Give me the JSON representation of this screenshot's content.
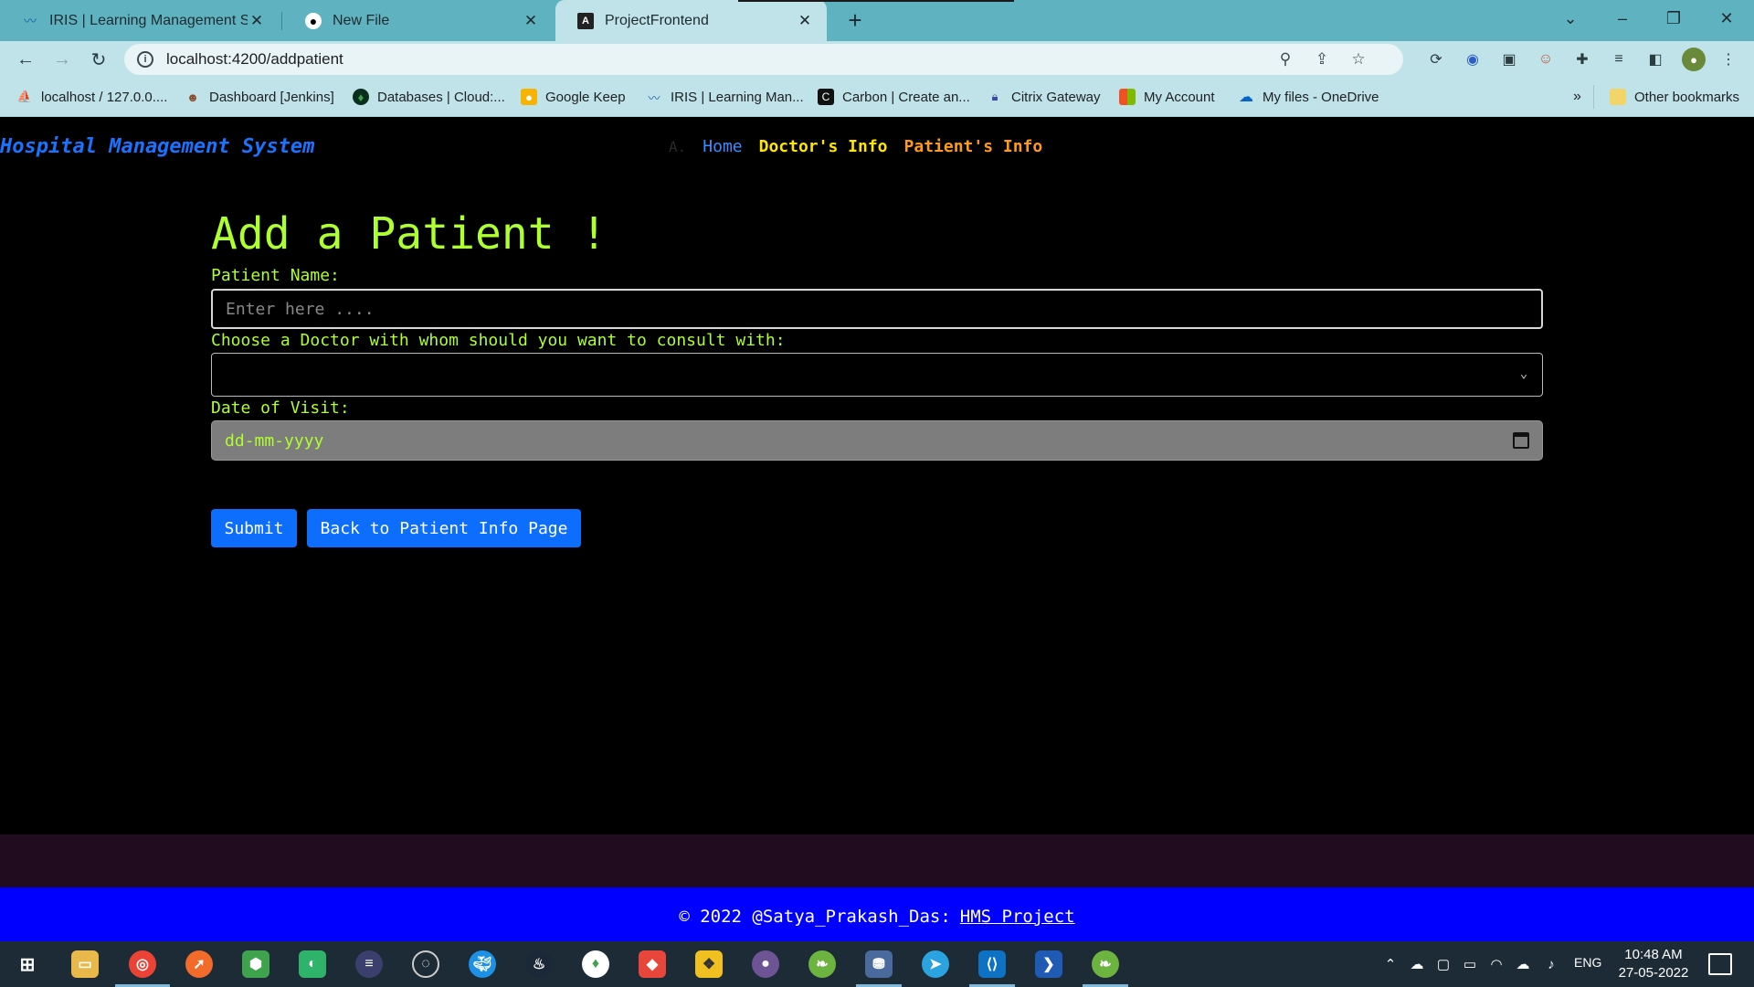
{
  "browser": {
    "tabs": [
      {
        "title": "IRIS | Learning Management Syst",
        "icon": "iris-icon"
      },
      {
        "title": "New File",
        "icon": "github-icon"
      },
      {
        "title": "ProjectFrontend",
        "icon": "angular-icon"
      }
    ],
    "url": "localhost:4200/addpatient",
    "bookmarks": [
      {
        "label": "localhost / 127.0.0....",
        "icon": "phpmyadmin-icon"
      },
      {
        "label": "Dashboard [Jenkins]",
        "icon": "jenkins-icon"
      },
      {
        "label": "Databases | Cloud:...",
        "icon": "mongodb-icon"
      },
      {
        "label": "Google Keep",
        "icon": "keep-icon"
      },
      {
        "label": "IRIS | Learning Man...",
        "icon": "iris-icon"
      },
      {
        "label": "Carbon | Create an...",
        "icon": "carbon-icon"
      },
      {
        "label": "Citrix Gateway",
        "icon": "lock-icon"
      },
      {
        "label": "My Account",
        "icon": "microsoft-icon"
      },
      {
        "label": "My files - OneDrive",
        "icon": "onedrive-icon"
      }
    ],
    "more_bookmarks": "»",
    "other_bookmarks": "Other bookmarks"
  },
  "app": {
    "brand": "Hospital Management System",
    "nav": {
      "ghost": "A.",
      "home": "Home",
      "doctors": "Doctor's Info",
      "patients": "Patient's Info"
    }
  },
  "form": {
    "heading": "Add a Patient !",
    "name_label": "Patient Name:",
    "name_placeholder": "Enter here ....",
    "doctor_label": "Choose a Doctor with whom should you want to consult with:",
    "doctor_value": "",
    "date_label": "Date of Visit:",
    "date_placeholder": "dd-mm-yyyy",
    "submit_label": "Submit",
    "back_label": "Back to Patient Info Page"
  },
  "footer": {
    "text": "© 2022 @Satya_Prakash_Das:",
    "link": "HMS Project"
  },
  "taskbar": {
    "language": "ENG",
    "time": "10:48 AM",
    "date": "27-05-2022"
  },
  "colors": {
    "accent_green": "#adff2f",
    "brand_blue": "#1a73ff",
    "button_blue": "#0d6efd",
    "footer_blue": "#0000ff",
    "nav_yellow": "#ffe600",
    "nav_orange": "#ff9a1a"
  }
}
